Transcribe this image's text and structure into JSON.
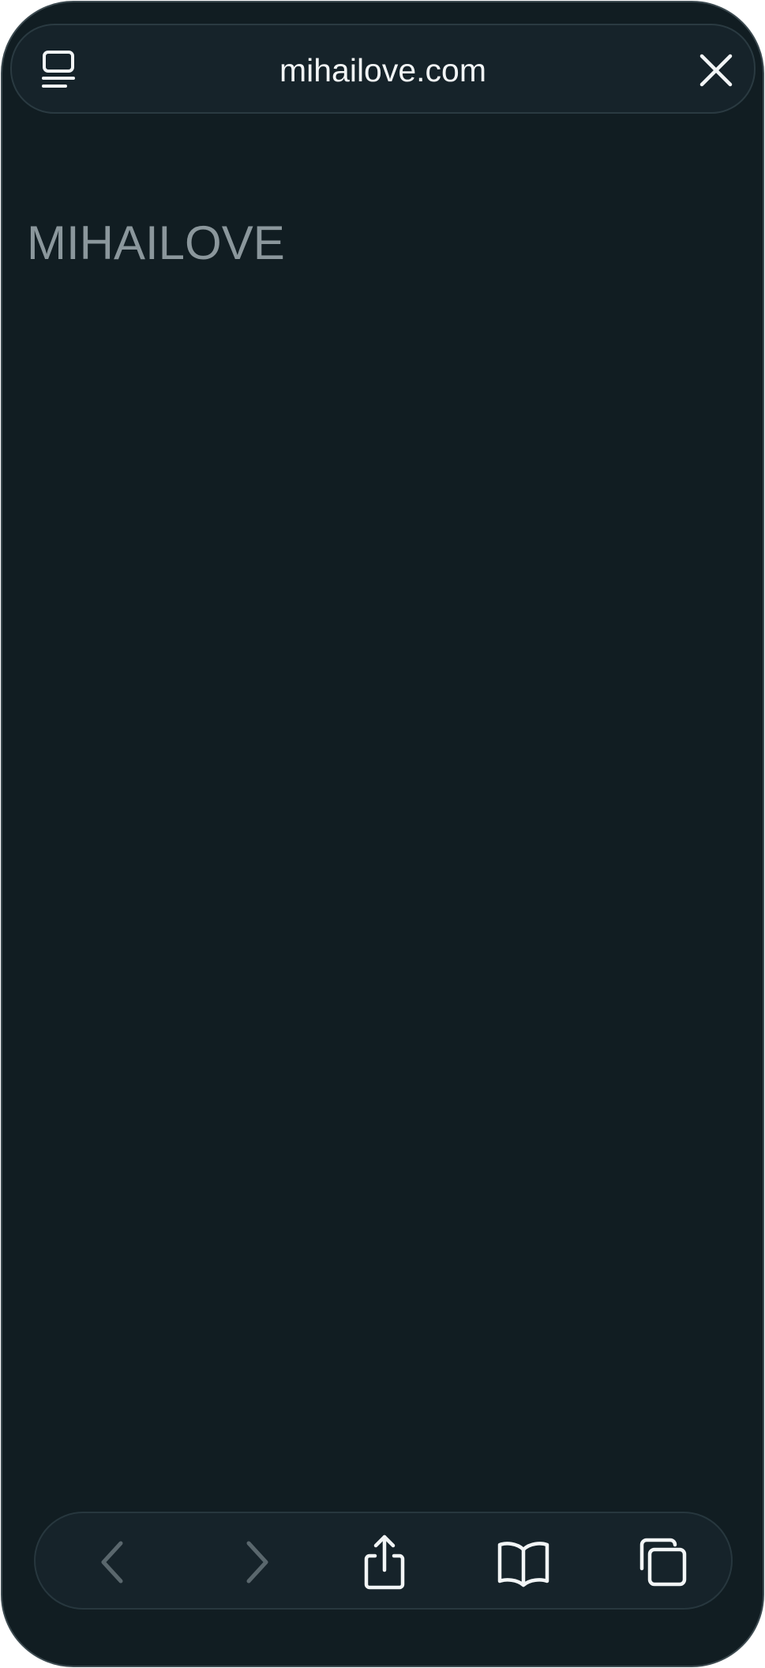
{
  "browser": {
    "url_display": "mihailove.com",
    "icons": {
      "reader": "reader-mode-icon",
      "close": "close-icon",
      "back": "chevron-left-icon",
      "forward": "chevron-right-icon",
      "share": "share-icon",
      "bookmarks": "book-icon",
      "tabs": "tabs-icon"
    },
    "colors": {
      "background": "#111d22",
      "bar": "#16232a",
      "text": "#f2f5f6",
      "disabled_icon": "#5a676d"
    }
  },
  "page": {
    "logo_text": "MIHAILOVE"
  }
}
